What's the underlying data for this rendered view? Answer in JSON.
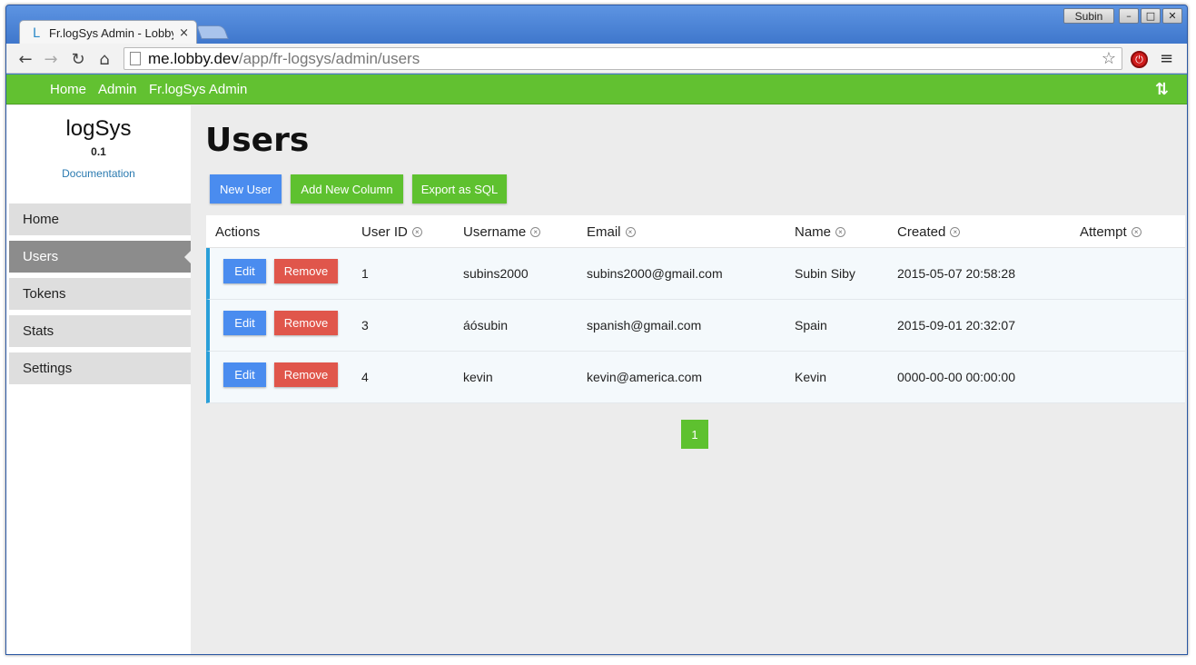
{
  "browser": {
    "tab_title": "Fr.logSys Admin - Lobby",
    "tab_favicon": "L",
    "close_glyph": "×",
    "profile_name": "Subin",
    "minimize_glyph": "–",
    "maximize_glyph": "□",
    "close_window_glyph": "✕",
    "back_glyph": "←",
    "forward_glyph": "→",
    "reload_glyph": "↻",
    "home_glyph": "⌂",
    "url_host": "me.lobby.dev",
    "url_path": "/app/fr-logsys/admin/users",
    "star_glyph": "☆",
    "extension_glyph": "⏻",
    "menu_glyph": "≡"
  },
  "topnav": {
    "items": [
      "Home",
      "Admin",
      "Fr.logSys Admin"
    ],
    "toggle_glyph": "⇅",
    "bar_color": "#62c131"
  },
  "sidebar": {
    "brand": "logSys",
    "version": "0.1",
    "doc_link": "Documentation",
    "items": [
      {
        "label": "Home",
        "active": false
      },
      {
        "label": "Users",
        "active": true
      },
      {
        "label": "Tokens",
        "active": false
      },
      {
        "label": "Stats",
        "active": false
      },
      {
        "label": "Settings",
        "active": false
      }
    ]
  },
  "main": {
    "title": "Users",
    "buttons": {
      "new_user": "New User",
      "add_column": "Add New Column",
      "export_sql": "Export as SQL"
    },
    "table": {
      "remove_column_glyph": "×",
      "headers": [
        "Actions",
        "User ID",
        "Username",
        "Email",
        "Name",
        "Created",
        "Attempt"
      ],
      "edit_label": "Edit",
      "remove_label": "Remove",
      "rows": [
        {
          "id": "1",
          "username": "subins2000",
          "email": "subins2000@gmail.com",
          "name": "Subin Siby",
          "created": "2015-05-07 20:58:28",
          "attempt": ""
        },
        {
          "id": "3",
          "username": "áósubin",
          "email": "spanish@gmail.com",
          "name": "Spain",
          "created": "2015-09-01 20:32:07",
          "attempt": ""
        },
        {
          "id": "4",
          "username": "kevin",
          "email": "kevin@america.com",
          "name": "Kevin",
          "created": "0000-00-00 00:00:00",
          "attempt": ""
        }
      ]
    },
    "pagination": {
      "current": "1"
    }
  },
  "colors": {
    "accent_blue": "#4a8cef",
    "accent_green": "#5ec12f",
    "danger_red": "#e0564b",
    "row_highlight": "#2a9fd8"
  }
}
